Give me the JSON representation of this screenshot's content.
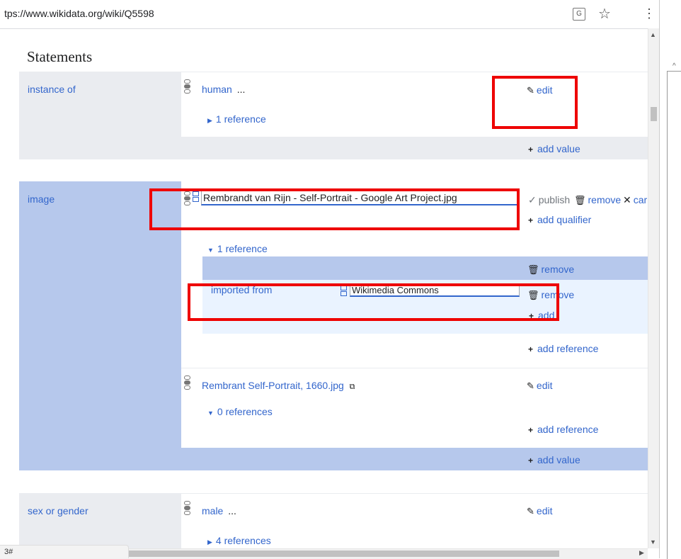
{
  "browser": {
    "url": "tps://www.wikidata.org/wiki/Q5598",
    "status_text": "3#"
  },
  "heading": "Statements",
  "statements": {
    "instance_of": {
      "property": "instance of",
      "value": "human",
      "more": "...",
      "references": "1 reference",
      "edit": "edit",
      "add_value": "add value"
    },
    "image": {
      "property": "image",
      "editing_value": "Rembrandt van Rijn - Self-Portrait - Google Art Project.jpg",
      "publish": "publish",
      "remove": "remove",
      "cancel": "car",
      "add_qualifier": "add qualifier",
      "references": "1 reference",
      "ref_remove": "remove",
      "ref_property": "imported from",
      "ref_value": "Wikimedia Commons",
      "snak_remove": "remove",
      "snak_add": "add",
      "add_reference": "add reference",
      "value2": "Rembrant Self-Portrait, 1660.jpg",
      "value2_edit": "edit",
      "value2_references": "0 references",
      "value2_add_reference": "add reference",
      "add_value": "add value"
    },
    "sex_or_gender": {
      "property": "sex or gender",
      "value": "male",
      "more": "...",
      "references": "4 references",
      "edit": "edit"
    }
  },
  "colors": {
    "link": "#3366cc",
    "annotation_red": "#ee0000",
    "editing_blue": "#b6c8ec",
    "gray_cell": "#eaecf0"
  }
}
